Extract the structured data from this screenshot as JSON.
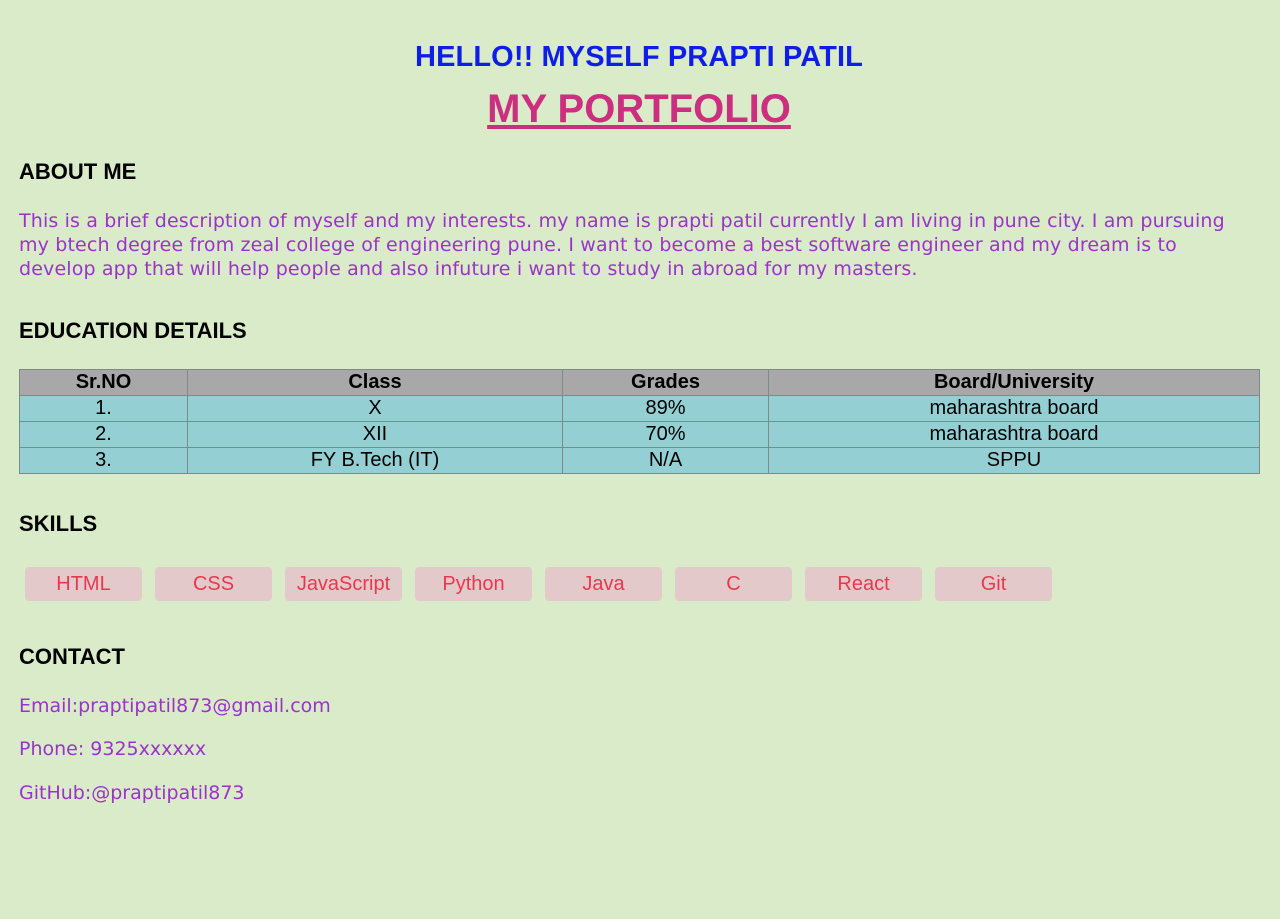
{
  "header": {
    "greeting": "HELLO!! MYSELF PRAPTI PATIL",
    "title": "MY PORTFOLIO"
  },
  "about": {
    "heading": "ABOUT ME",
    "text": "This is a brief description of myself and my interests. my name is prapti patil currently I am living in pune city. I am pursuing my btech degree from zeal college of engineering pune. I want to become a best software engineer and my dream is to develop app that will help people and also infuture i want to study in abroad for my masters."
  },
  "education": {
    "heading": "EDUCATION DETAILS",
    "columns": [
      "Sr.NO",
      "Class",
      "Grades",
      "Board/University"
    ],
    "rows": [
      [
        "1.",
        "X",
        "89%",
        "maharashtra board"
      ],
      [
        "2.",
        "XII",
        "70%",
        "maharashtra board"
      ],
      [
        "3.",
        "FY B.Tech (IT)",
        "N/A",
        "SPPU"
      ]
    ]
  },
  "skills": {
    "heading": "SKILLS",
    "items": [
      "HTML",
      "CSS",
      "JavaScript",
      "Python",
      "Java",
      "C",
      "React",
      "Git"
    ]
  },
  "contact": {
    "heading": "CONTACT",
    "email": "Email:praptipatil873@gmail.com",
    "phone": "Phone: 9325xxxxxx",
    "github": "GitHub:@praptipatil873"
  },
  "colors": {
    "background": "#d9ebc8",
    "greeting": "#0f1ee6",
    "portfolio_title": "#cc2f7f",
    "body_text": "#9b33c8",
    "table_header": "#a8a8a8",
    "table_cell": "#93cfd3",
    "skill_badge": "#e4c9cb",
    "skill_text": "#e8384f"
  }
}
